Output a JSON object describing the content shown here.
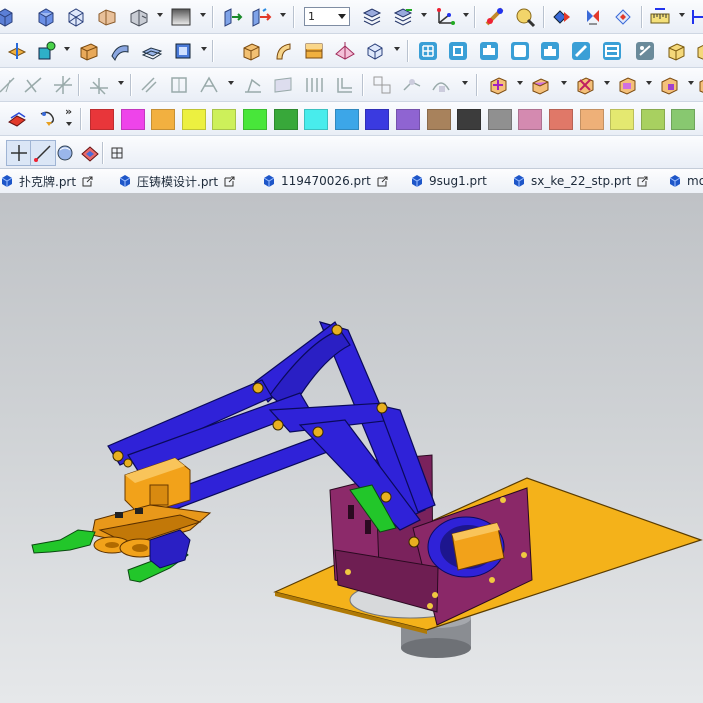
{
  "window": {
    "app": "UG NX (CAD)"
  },
  "toolbar": {
    "layer_select": {
      "value": "1"
    }
  },
  "color_palette": [
    "#e8363a",
    "#ee44ea",
    "#f2b040",
    "#ecf040",
    "#cdf05a",
    "#48e63a",
    "#38a83a",
    "#48ecec",
    "#3ca6e8",
    "#3a3ae0",
    "#8f64d2",
    "#a8825c",
    "#3c3c3c",
    "#909090",
    "#d48ab0",
    "#e07868",
    "#eeb078",
    "#e4e870",
    "#a8d060",
    "#88c870"
  ],
  "tabs": [
    {
      "label": "扑克牌.prt",
      "modified_icon": true
    },
    {
      "label": "压铸模设计.prt",
      "modified_icon": true
    },
    {
      "label": "119470026.prt",
      "modified_icon": true
    },
    {
      "label": "9sug1.prt",
      "modified_icon": false
    },
    {
      "label": "sx_ke_22_stp.prt",
      "modified_icon": true
    },
    {
      "label": "mo",
      "modified_icon": false
    }
  ],
  "model": {
    "arm_color": "#2f22d8",
    "base_plate_color": "#f4b21a",
    "frame_color": "#8c2a6a",
    "motor_color": "#f2a21a",
    "gripper_color": "#22c62a"
  }
}
